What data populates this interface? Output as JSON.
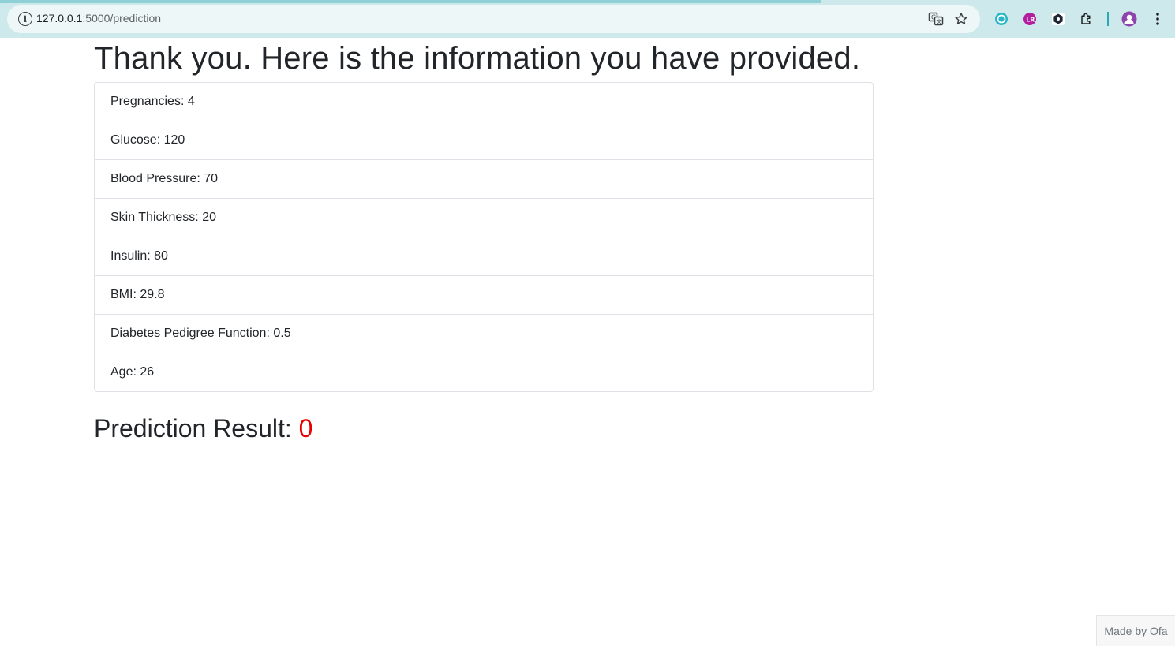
{
  "browser": {
    "url_host": "127.0.0.1",
    "url_path": ":5000/prediction",
    "site_info_glyph": "i",
    "icons": [
      "site-info-icon",
      "translate-icon",
      "bookmark-star-icon",
      "extension-1-icon",
      "extension-2-icon",
      "extension-3-icon",
      "extensions-puzzle-icon",
      "profile-avatar-icon",
      "more-menu-icon"
    ],
    "accent_color": "#2aa9b4"
  },
  "page": {
    "title": "Thank you. Here is the information you have provided.",
    "fields": [
      "Pregnancies: 4",
      "Glucose: 120",
      "Blood Pressure: 70",
      "Skin Thickness: 20",
      "Insulin: 80",
      "BMI: 29.8",
      "Diabetes Pedigree Function: 0.5",
      "Age: 26"
    ],
    "result_label": "Prediction Result:",
    "result_value": "0",
    "result_color": "#e60000"
  },
  "footer": {
    "text": "Made by Ofa"
  }
}
